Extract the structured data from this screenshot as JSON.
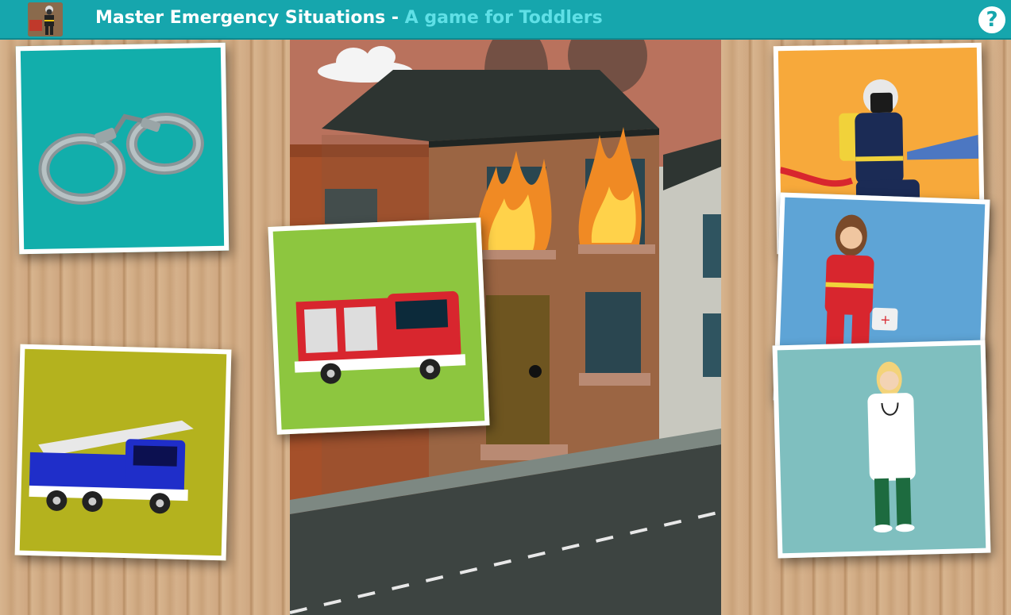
{
  "header": {
    "title": "Master Emergency Situations",
    "separator": " - ",
    "subtitle": "A game for Toddlers",
    "help_label": "?",
    "logo_icon": "firefighter-logo-icon"
  },
  "cards": [
    {
      "name": "handcuffs-card",
      "icon": "handcuffs-icon",
      "background": "#12aeab"
    },
    {
      "name": "ladder-truck-card",
      "icon": "ladder-truck-icon",
      "background": "#b4b21e"
    },
    {
      "name": "fire-engine-card",
      "icon": "fire-engine-icon",
      "background": "#8dc63f"
    },
    {
      "name": "firefighter-card",
      "icon": "firefighter-icon",
      "background": "#f7a93b"
    },
    {
      "name": "paramedic-card",
      "icon": "paramedic-icon",
      "background": "#5ea4d6"
    },
    {
      "name": "doctor-card",
      "icon": "doctor-icon",
      "background": "#7fbfbf"
    }
  ],
  "colors": {
    "header_bar": "#16a6ad",
    "subtitle": "#5fe0e6",
    "sky": "#b9725d",
    "road": "#3d4441"
  }
}
